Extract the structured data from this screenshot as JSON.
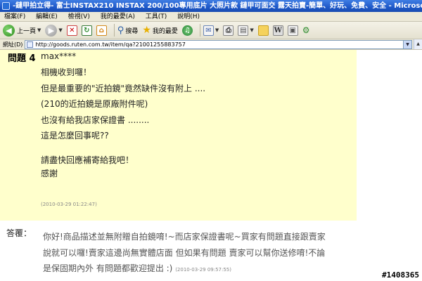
{
  "window": {
    "title": "-鏈甲拍立得- 富士INSTAX210 INSTAX 200/100專用底片 大照片款 鏈甲可面交  露天拍賣-簡單、好玩、免費、安全 - Microsoft In..."
  },
  "menu": {
    "items": [
      "檔案(F)",
      "編輯(E)",
      "檢視(V)",
      "我的最愛(A)",
      "工具(T)",
      "說明(H)"
    ]
  },
  "toolbar": {
    "back_label": "上一頁",
    "search_label": "搜尋",
    "favorites_label": "我的最愛"
  },
  "address": {
    "label": "網址(D)",
    "url": "http://goods.ruten.com.tw/item/qa?21001255883757"
  },
  "question": {
    "label": "問題 4",
    "user": "max****",
    "lines": [
      "相機收到囉！",
      "但是最重要的\"近拍鏡\"竟然缺件沒有附上 ....",
      "(210的近拍鏡是原廠附件呢)",
      "也沒有給我店家保證書 ........",
      "這是怎麼回事呢??",
      "",
      "請盡快回應補寄給我吧！",
      "感謝"
    ],
    "timestamp": "(2010-03-29 01:22:47)"
  },
  "answer": {
    "label": "答覆：",
    "lines": [
      "你好!商品描述並無附贈自拍鏡唷!~而店家保證書呢~買家有問題直接跟賣家",
      "說就可以囉!賣家這邊尚無實體店面 但如果有問題 賣家可以幫你送修唷!不論",
      "是保固期內外 有問題都歡迎提出 :)"
    ],
    "timestamp": "(2010-03-29 09:57:55)"
  },
  "watermark": "#1408365"
}
